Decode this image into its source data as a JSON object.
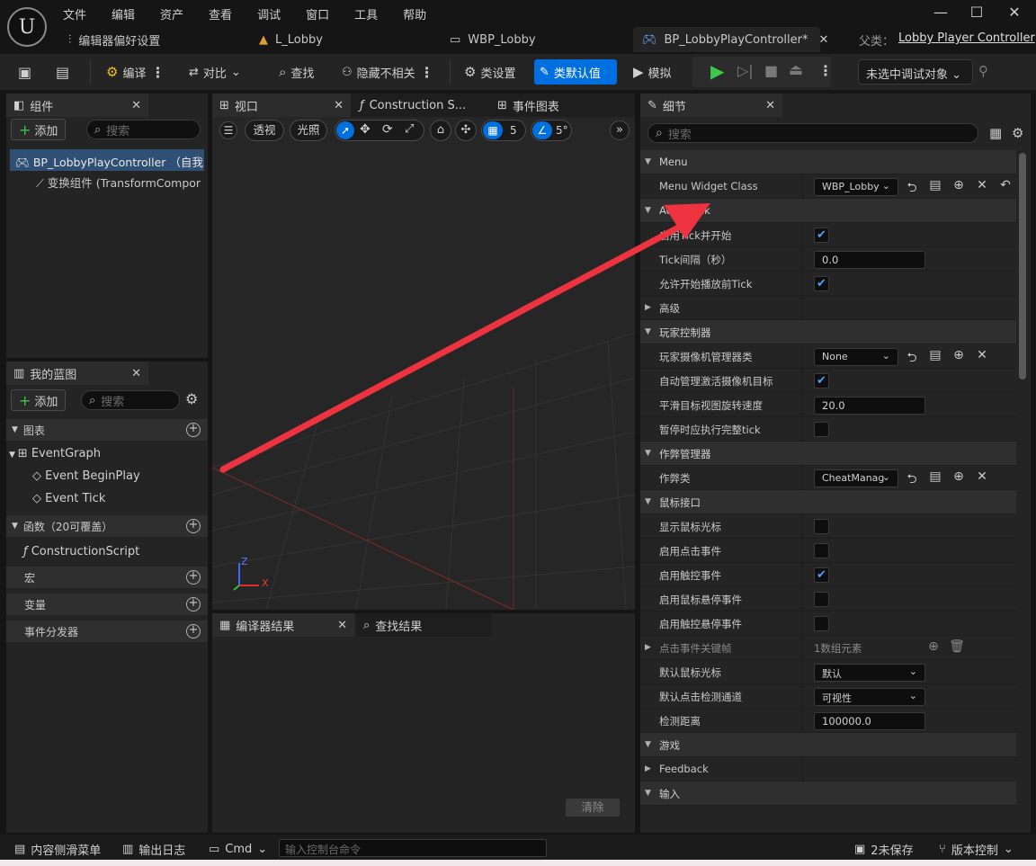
{
  "app": {
    "logo": "unreal-logo"
  },
  "menu": [
    "文件",
    "编辑",
    "资产",
    "查看",
    "调试",
    "窗口",
    "工具",
    "帮助"
  ],
  "doc_tabs": [
    {
      "label": "编辑器偏好设置",
      "icon": "sliders-icon"
    },
    {
      "label": "L_Lobby",
      "icon": "level-icon"
    },
    {
      "label": "WBP_Lobby",
      "icon": "widget-icon"
    },
    {
      "label": "BP_LobbyPlayController*",
      "icon": "gamepad-icon"
    }
  ],
  "parent": {
    "label": "父类：",
    "value": "Lobby Player Controller"
  },
  "toolbar": {
    "compile": "编译",
    "diff": "对比",
    "find": "查找",
    "hide_unrelated": "隐藏不相关",
    "class_settings": "类设置",
    "class_defaults": "类默认值",
    "simulate": "模拟",
    "debug_target": "未选中调试对象"
  },
  "components": {
    "tab": "组件",
    "add": "添加",
    "search_placeholder": "搜索",
    "root": "BP_LobbyPlayController （自我",
    "child": "变换组件 (TransformCompor"
  },
  "viewport_tabs": {
    "viewport": "视口",
    "construction": "Construction S...",
    "event_graph": "事件图表"
  },
  "viewport": {
    "perspective": "透视",
    "lit": "光照",
    "grid_value": "5",
    "angle_value": "5°",
    "axis_z": "Z",
    "axis_x": "X"
  },
  "blueprint": {
    "tab": "我的蓝图",
    "add": "添加",
    "search_placeholder": "搜索",
    "graphs": "图表",
    "event_graph": "EventGraph",
    "begin_play": "Event BeginPlay",
    "tick": "Event Tick",
    "functions": "函数（20可覆盖）",
    "construction_script": "ConstructionScript",
    "macros": "宏",
    "variables": "变量",
    "dispatchers": "事件分发器"
  },
  "bottom": {
    "compiler_results": "编译器结果",
    "find_results": "查找结果",
    "clear": "清除"
  },
  "details": {
    "tab": "细节",
    "search_placeholder": "搜索",
    "rows": [
      {
        "type": "cat",
        "name": "Menu"
      },
      {
        "type": "combo",
        "name": "Menu Widget Class",
        "value": "WBP_Lobby"
      },
      {
        "type": "cat",
        "name": "Actor Tick"
      },
      {
        "type": "check",
        "name": "启用Tick并开始",
        "checked": true
      },
      {
        "type": "field",
        "name": "Tick间隔（秒）",
        "value": "0.0"
      },
      {
        "type": "check",
        "name": "允许开始播放前Tick",
        "checked": true
      },
      {
        "type": "collapsed",
        "name": "高级"
      },
      {
        "type": "cat",
        "name": "玩家控制器"
      },
      {
        "type": "combo",
        "name": "玩家摄像机管理器类",
        "value": "None"
      },
      {
        "type": "check",
        "name": "自动管理激活摄像机目标",
        "checked": true
      },
      {
        "type": "field",
        "name": "平滑目标视图旋转速度",
        "value": "20.0"
      },
      {
        "type": "check",
        "name": "暂停时应执行完整tick",
        "checked": false
      },
      {
        "type": "cat",
        "name": "作弊管理器"
      },
      {
        "type": "combo",
        "name": "作弊类",
        "value": "CheatManag"
      },
      {
        "type": "cat",
        "name": "鼠标接口"
      },
      {
        "type": "check",
        "name": "显示鼠标光标",
        "checked": false
      },
      {
        "type": "check",
        "name": "启用点击事件",
        "checked": false
      },
      {
        "type": "check",
        "name": "启用触控事件",
        "checked": true
      },
      {
        "type": "check",
        "name": "启用鼠标悬停事件",
        "checked": false
      },
      {
        "type": "check",
        "name": "启用触控悬停事件",
        "checked": false
      },
      {
        "type": "array",
        "name": "点击事件关键帧",
        "value": "1数组元素"
      },
      {
        "type": "select",
        "name": "默认鼠标光标",
        "value": "默认"
      },
      {
        "type": "select",
        "name": "默认点击检测通道",
        "value": "可视性"
      },
      {
        "type": "field",
        "name": "检测距离",
        "value": "100000.0"
      },
      {
        "type": "cat",
        "name": "游戏"
      },
      {
        "type": "collapsed",
        "name": "Feedback"
      },
      {
        "type": "cat",
        "name": "输入"
      }
    ]
  },
  "statusbar": {
    "content_drawer": "内容侧滑菜单",
    "output_log": "输出日志",
    "cmd": "Cmd",
    "console_placeholder": "输入控制台命令",
    "unsaved": "2未保存",
    "source_control": "版本控制"
  },
  "colors": {
    "accent": "#0070e0",
    "arrow": "#ee3340",
    "check": "#4aa3ff",
    "play": "#3cc84a"
  }
}
